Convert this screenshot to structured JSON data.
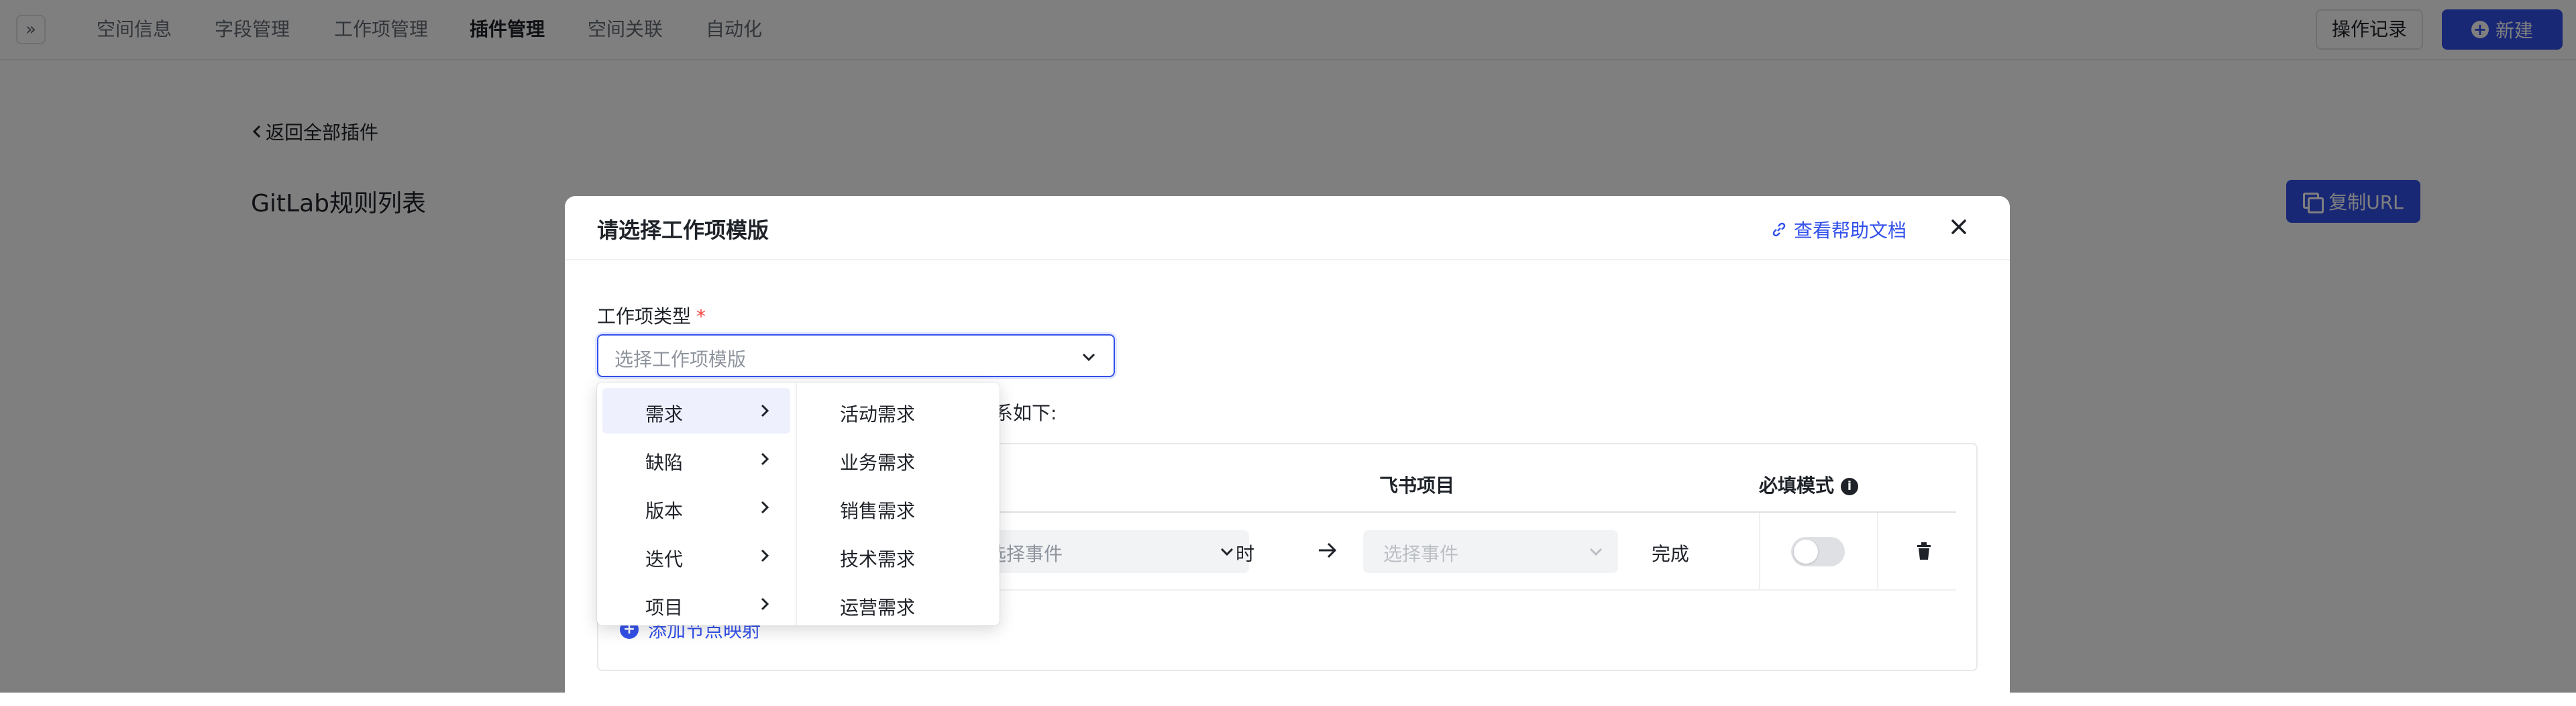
{
  "topbar": {
    "tabs": [
      {
        "label": "空间信息"
      },
      {
        "label": "字段管理"
      },
      {
        "label": "工作项管理"
      },
      {
        "label": "插件管理",
        "active": true
      },
      {
        "label": "空间关联"
      },
      {
        "label": "自动化"
      }
    ],
    "ops_label": "操作记录",
    "new_label": "新建"
  },
  "page": {
    "back_label": "返回全部插件",
    "title": "GitLab规则列表",
    "copy_url_label": "复制URL"
  },
  "modal": {
    "title": "请选择工作项模版",
    "help_label": "查看帮助文档",
    "field_label": "工作项类型",
    "required_mark": "*",
    "select_placeholder": "选择工作项模版",
    "desc_text": "系如下:",
    "mapping": {
      "col_feishu": "飞书项目",
      "col_required": "必填模式",
      "row": {
        "source_event_placeholder": "选择事件",
        "when_label": "时",
        "target_event_placeholder": "选择事件",
        "done_label": "完成",
        "required_toggle": "off"
      },
      "add_label": "添加节点映射"
    }
  },
  "cascader": {
    "level1": [
      {
        "label": "需求",
        "active": true
      },
      {
        "label": "缺陷"
      },
      {
        "label": "版本"
      },
      {
        "label": "迭代"
      },
      {
        "label": "项目"
      }
    ],
    "level2": [
      {
        "label": "活动需求"
      },
      {
        "label": "业务需求"
      },
      {
        "label": "销售需求"
      },
      {
        "label": "技术需求"
      },
      {
        "label": "运营需求"
      }
    ]
  },
  "colors": {
    "accent": "#3250eb",
    "required": "#f54a45",
    "overlay": "rgba(0,0,0,0.5)"
  }
}
